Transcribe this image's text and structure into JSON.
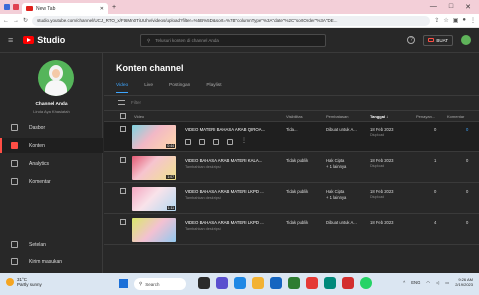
{
  "browser": {
    "tab_title": "New Tab",
    "url": "studio.youtube.com/channel/UCJ_RTO_x/Ft6Mn0TiUUhv/videos/upload?filter=%5B%5D&sort=%7B\"columnType\"%3A\"date\"%2C\"sortOrder\"%3A\"DE...",
    "new_tab_symbol": "+",
    "window_controls": [
      "—",
      "□",
      "✕"
    ]
  },
  "studio": {
    "logo_text": "Studio",
    "search_placeholder": "Telusuri konten di channel Anda",
    "create_label": "BUAT"
  },
  "channel": {
    "name": "Channel Anda",
    "subtitle": "Linda Aya Khasiatah"
  },
  "sidebar": {
    "items": [
      {
        "label": "Dasbor",
        "icon": "dashboard-icon"
      },
      {
        "label": "Konten",
        "icon": "content-icon",
        "active": true
      },
      {
        "label": "Analytics",
        "icon": "analytics-icon"
      },
      {
        "label": "Komentar",
        "icon": "comments-icon"
      },
      {
        "label": "Setelan",
        "icon": "settings-icon"
      },
      {
        "label": "Kirim masukan",
        "icon": "feedback-icon"
      }
    ]
  },
  "main": {
    "title": "Konten channel",
    "tabs": [
      "Video",
      "Live",
      "Postingan",
      "Playlist"
    ],
    "filter_label": "Filter",
    "columns": [
      "Video",
      "Visibilitas",
      "Pembatasan",
      "Tanggal ↓",
      "Penayan...",
      "Komentar"
    ]
  },
  "videos": [
    {
      "title": "VIDEO MATERI BAHASA ARAB QIROA...",
      "desc": "",
      "duration": "0:44",
      "visibility": "Tida...",
      "restriction": "Dibuat untuk A...",
      "restriction_sub": "",
      "date": "18 Feb 2023",
      "date_sub": "Diupload",
      "views": "0",
      "comments": "0"
    },
    {
      "title": "VIDEO BAHASA ARAB MATERI KALA...",
      "desc": "Tambahkan deskripsi",
      "duration": "1:07",
      "visibility": "Tidak publik",
      "restriction": "Hak Cipta",
      "restriction_sub": "+ 1 lainnya",
      "date": "18 Feb 2023",
      "date_sub": "Diupload",
      "views": "1",
      "comments": "0"
    },
    {
      "title": "VIDEO BAHASA ARAB MATERI LKPD ...",
      "desc": "Tambahkan deskripsi",
      "duration": "1:11",
      "visibility": "Tidak publik",
      "restriction": "Hak Cipta",
      "restriction_sub": "+ 1 lainnya",
      "date": "18 Feb 2023",
      "date_sub": "Diupload",
      "views": "0",
      "comments": "0"
    },
    {
      "title": "VIDEO BAHASA ARAB MATERI LKPD ...",
      "desc": "Tambahkan deskripsi",
      "duration": "",
      "visibility": "Tidak publik",
      "restriction": "Dibuat untuk A...",
      "restriction_sub": "",
      "date": "18 Feb 2023",
      "date_sub": "",
      "views": "4",
      "comments": "0"
    }
  ],
  "taskbar": {
    "weather_temp": "31°C",
    "weather_desc": "Partly sunny",
    "search_label": "Search",
    "lang": "ENG",
    "time": "9:26 AM",
    "date": "2/19/2023"
  }
}
